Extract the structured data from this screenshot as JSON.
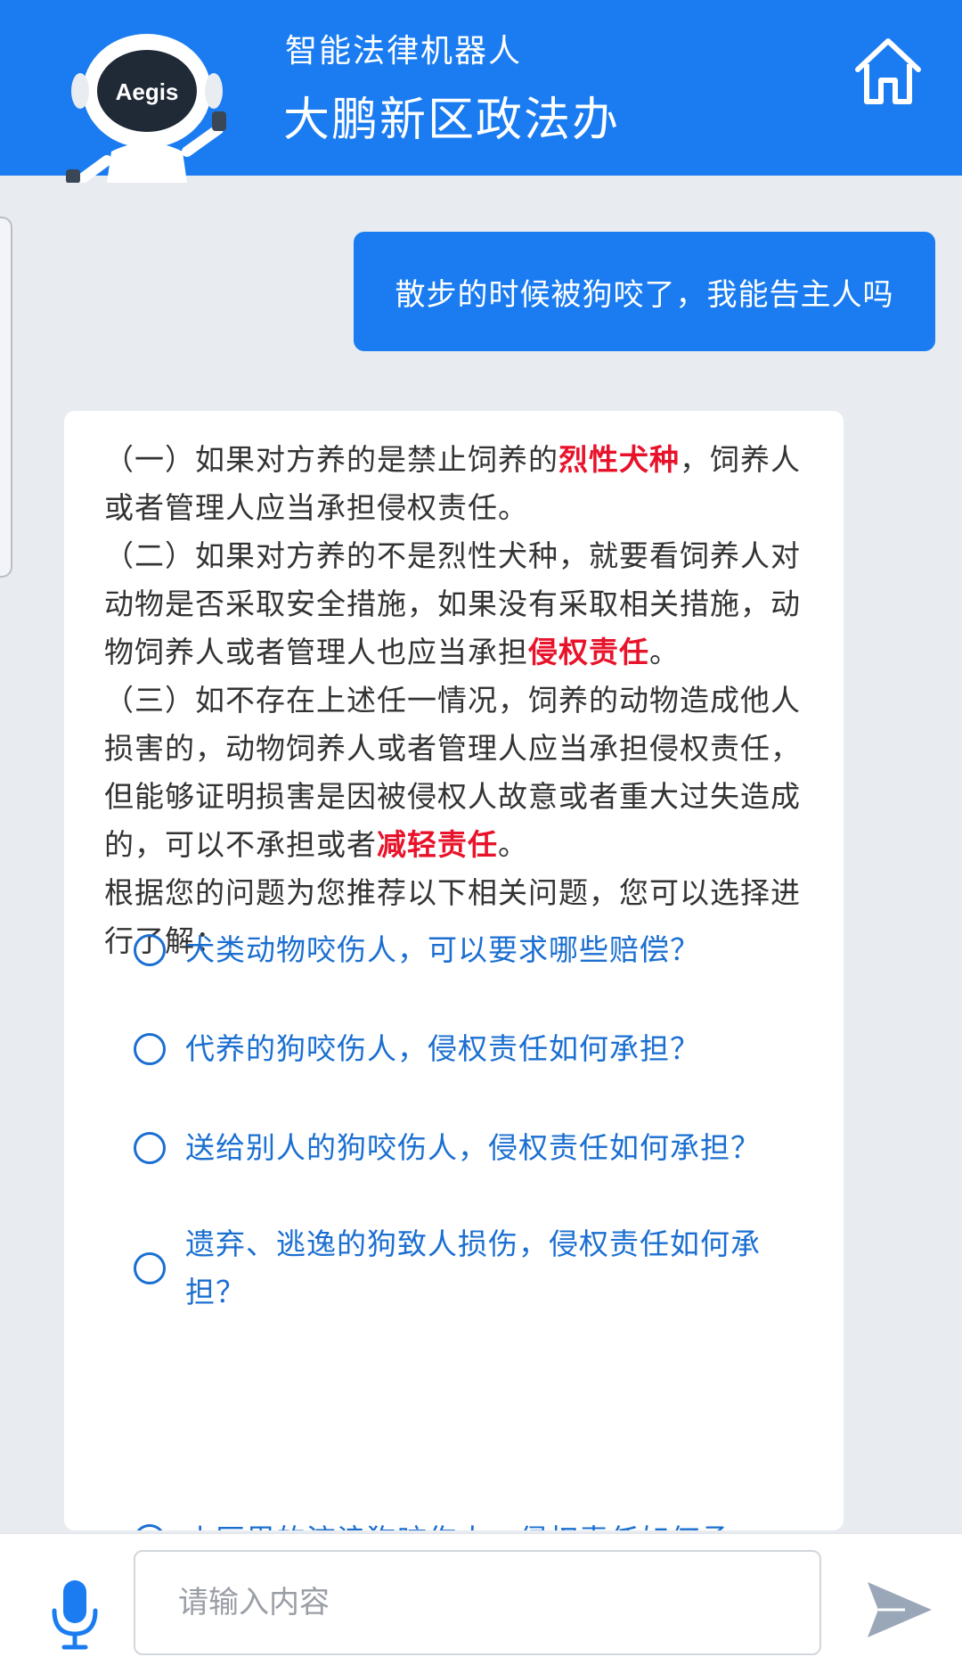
{
  "header": {
    "subtitle": "智能法律机器人",
    "title": "大鹏新区政法办",
    "logo_text": "Aegis",
    "accent_color": "#1a7cf0",
    "home_icon": "home-icon"
  },
  "chat": {
    "user_message": "散步的时候被狗咬了，我能告主人吗",
    "answer": {
      "p1_pre": "（一）如果对方养的是禁止饲养的",
      "p1_hl": "烈性犬种",
      "p1_post": "，饲养人或者管理人应当承担侵权责任。",
      "p2_pre": "（二）如果对方养的不是烈性犬种，就要看饲养人对动物是否采取安全措施，如果没有采取相关措施，动物饲养人或者管理人也应当承担",
      "p2_hl": "侵权责任",
      "p2_post": "。",
      "p3_pre": "（三）如不存在上述任一情况，饲养的动物造成他人损害的，动物饲养人或者管理人应当承担侵权责任，但能够证明损害是因被侵权人故意或者重大过失造成的，可以不承担或者",
      "p3_hl": "减轻责任",
      "p3_post": "。",
      "recommend": "根据您的问题为您推荐以下相关问题，您可以选择进行了解：",
      "highlight_color": "#e8132b"
    },
    "suggestions": [
      "犬类动物咬伤人，可以要求哪些赔偿？",
      "代养的狗咬伤人，侵权责任如何承担？",
      "送给别人的狗咬伤人，侵权责任如何承担？",
      "遗弃、逃逸的狗致人损伤，侵权责任如何承担？",
      "小区里的流浪狗咬伤人，侵权责任如何承"
    ],
    "suggestion_color": "#1b6fd1"
  },
  "input_bar": {
    "placeholder": "请输入内容",
    "value": "",
    "mic_icon": "microphone-icon",
    "send_icon": "send-icon"
  }
}
